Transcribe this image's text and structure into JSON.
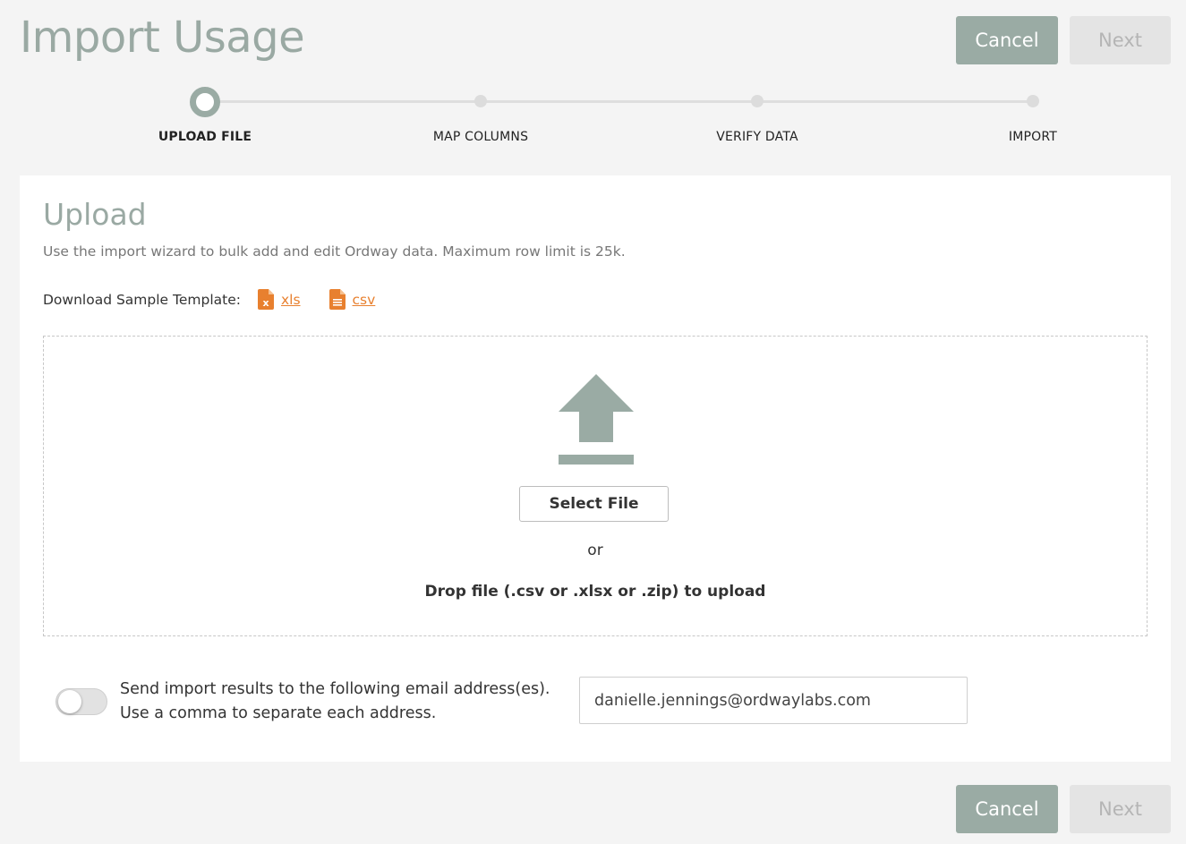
{
  "header": {
    "title": "Import Usage",
    "cancel_label": "Cancel",
    "next_label": "Next"
  },
  "stepper": {
    "steps": [
      {
        "label": "UPLOAD FILE",
        "active": true
      },
      {
        "label": "MAP COLUMNS",
        "active": false
      },
      {
        "label": "VERIFY DATA",
        "active": false
      },
      {
        "label": "IMPORT",
        "active": false
      }
    ]
  },
  "upload": {
    "title": "Upload",
    "description": "Use the import wizard to bulk add and edit Ordway data. Maximum row limit is 25k.",
    "template_label": "Download Sample Template:",
    "template_links": [
      {
        "label": "xls",
        "icon": "xls-file-icon"
      },
      {
        "label": "csv",
        "icon": "csv-file-icon"
      }
    ],
    "dropzone": {
      "icon": "upload-icon",
      "select_label": "Select File",
      "or_text": "or",
      "drop_text": "Drop file (.csv or .xlsx or .zip) to upload"
    },
    "email": {
      "toggle_on": false,
      "line1": "Send import results to the following email address(es).",
      "line2": "Use a comma to separate each address.",
      "value": "danielle.jennings@ordwaylabs.com"
    }
  },
  "footer": {
    "cancel_label": "Cancel",
    "next_label": "Next"
  },
  "colors": {
    "accent": "#9aaba4",
    "link": "#e8802f",
    "disabled": "#e4e4e4"
  }
}
